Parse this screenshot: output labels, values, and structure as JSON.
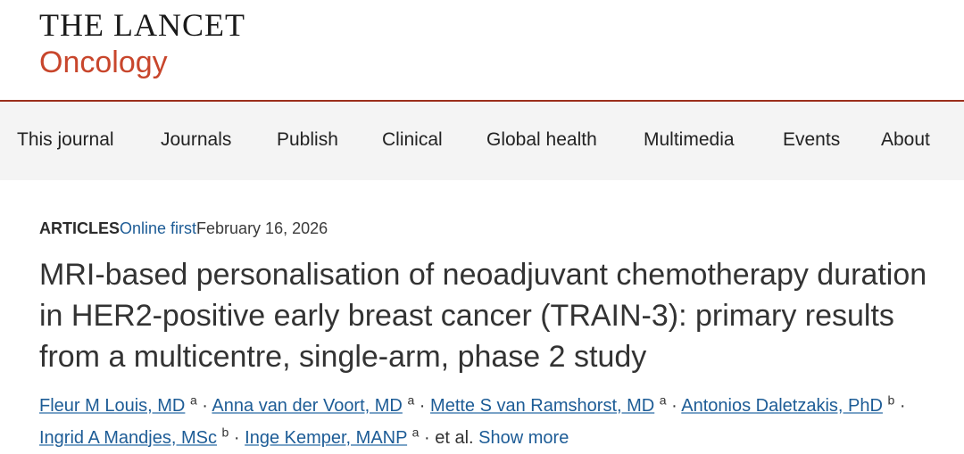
{
  "logo": {
    "top": "THE LANCET",
    "bottom": "Oncology"
  },
  "nav": {
    "items": [
      "This journal",
      "Journals",
      "Publish",
      "Clinical",
      "Global health",
      "Multimedia",
      "Events",
      "About"
    ]
  },
  "article": {
    "type": "ARTICLES",
    "status": "Online first",
    "date": "February 16, 2026",
    "title": "MRI-based personalisation of neoadjuvant chemotherapy duration in HER2-positive early breast cancer (TRAIN-3): primary results from a multicentre, single-arm, phase 2 study",
    "authors": [
      {
        "name": "Fleur M Louis, MD",
        "aff": "a"
      },
      {
        "name": "Anna van der Voort, MD",
        "aff": "a"
      },
      {
        "name": "Mette S van Ramshorst, MD",
        "aff": "a"
      },
      {
        "name": "Antonios Daletzakis, PhD",
        "aff": "b"
      },
      {
        "name": "Ingrid A Mandjes, MSc",
        "aff": "b"
      },
      {
        "name": "Inge Kemper, MANP",
        "aff": "a"
      }
    ],
    "separator": "·",
    "et_al": "et al.",
    "show_more": "Show more"
  }
}
